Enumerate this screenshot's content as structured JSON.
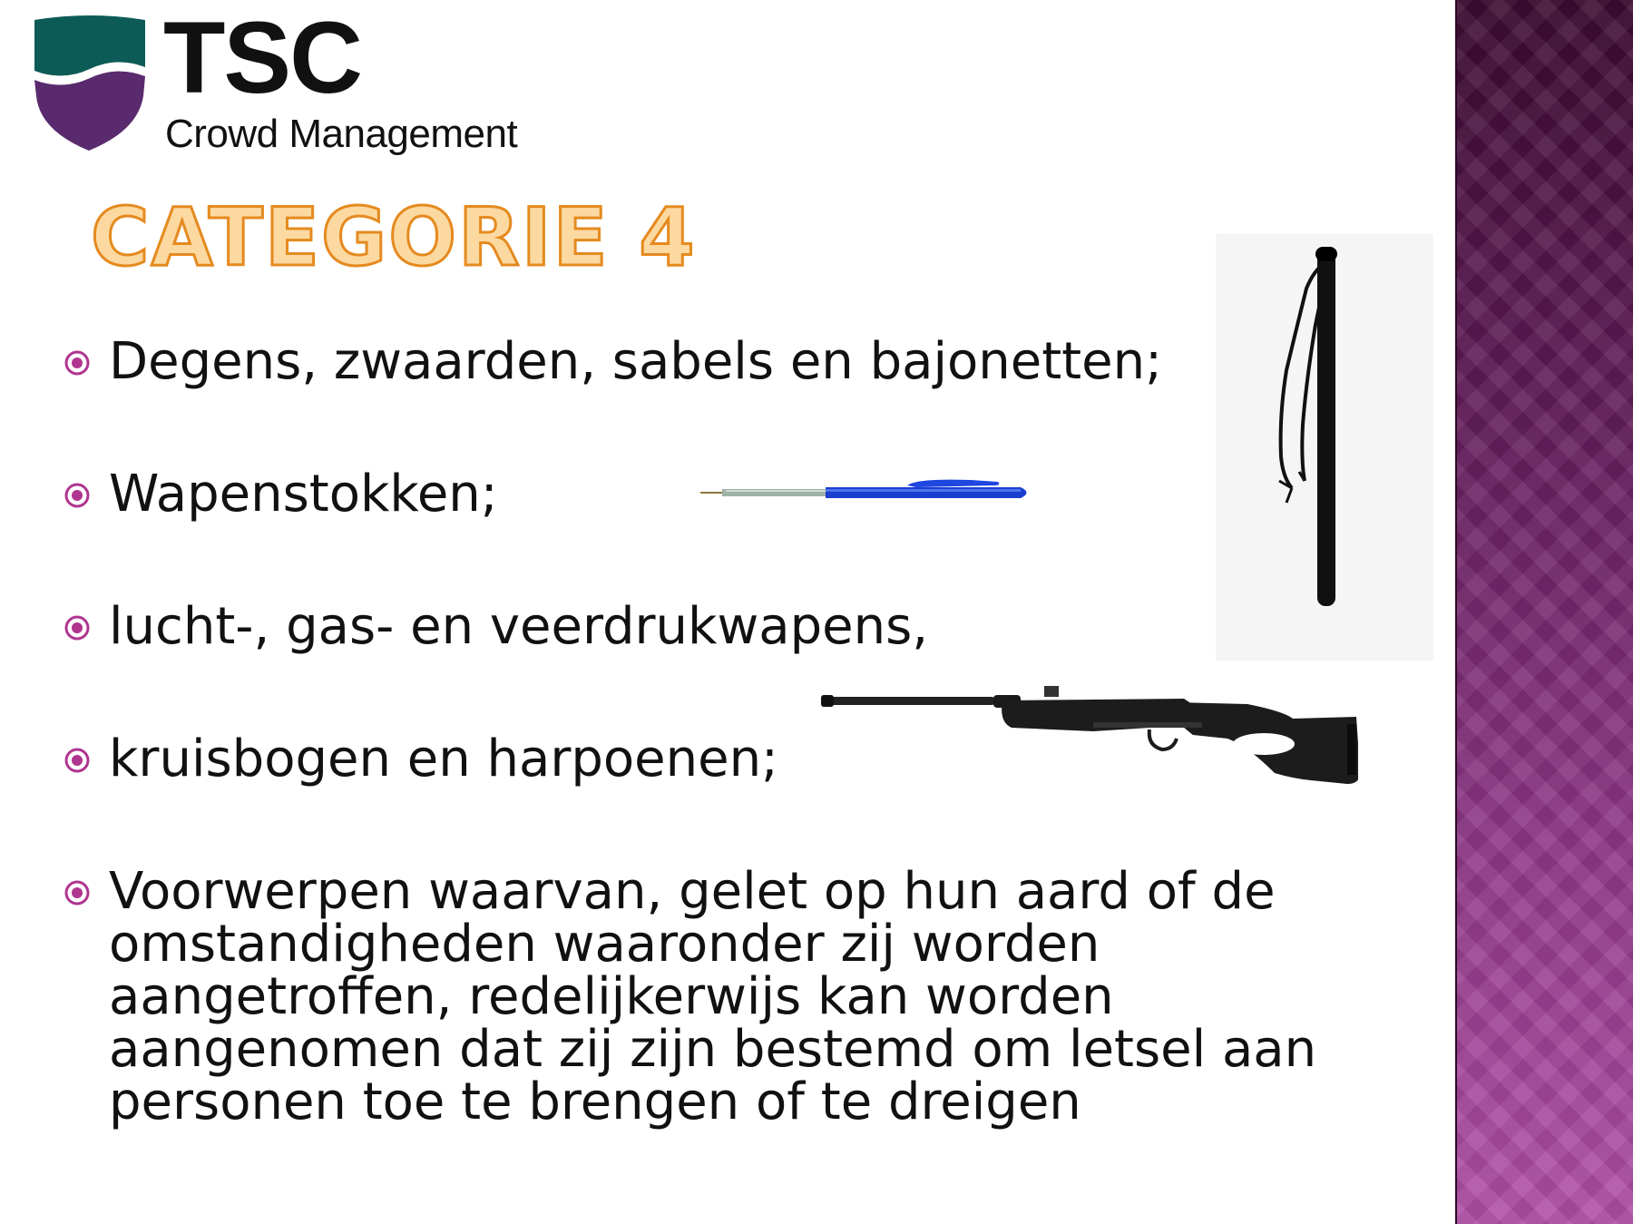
{
  "logo": {
    "wordmark": "TSC",
    "tagline": "Crowd Management",
    "colors": {
      "teal": "#0d5b57",
      "purple": "#5a2a6e"
    }
  },
  "title": "Categorie 4",
  "bullets": [
    "Degens, zwaarden, sabels en bajonetten;",
    "Wapenstokken;",
    "lucht-, gas- en veerdrukwapens,",
    "kruisbogen en harpoenen;",
    "Voorwerpen waarvan, gelet op hun aard of de omstandigheden waaronder zij worden aangetroffen, redelijkerwijs kan worden aangenomen dat zij zijn bestemd om letsel aan personen toe te brengen of te dreigen"
  ],
  "bullet_icon": "circle-dot-icon",
  "colors": {
    "title_fill": "#fcd9a0",
    "title_stroke": "#e58a1f",
    "bullet": "#b0358f",
    "side_band": "#8a3582"
  },
  "images": [
    "baton-image",
    "pen-image",
    "air-rifle-image"
  ]
}
